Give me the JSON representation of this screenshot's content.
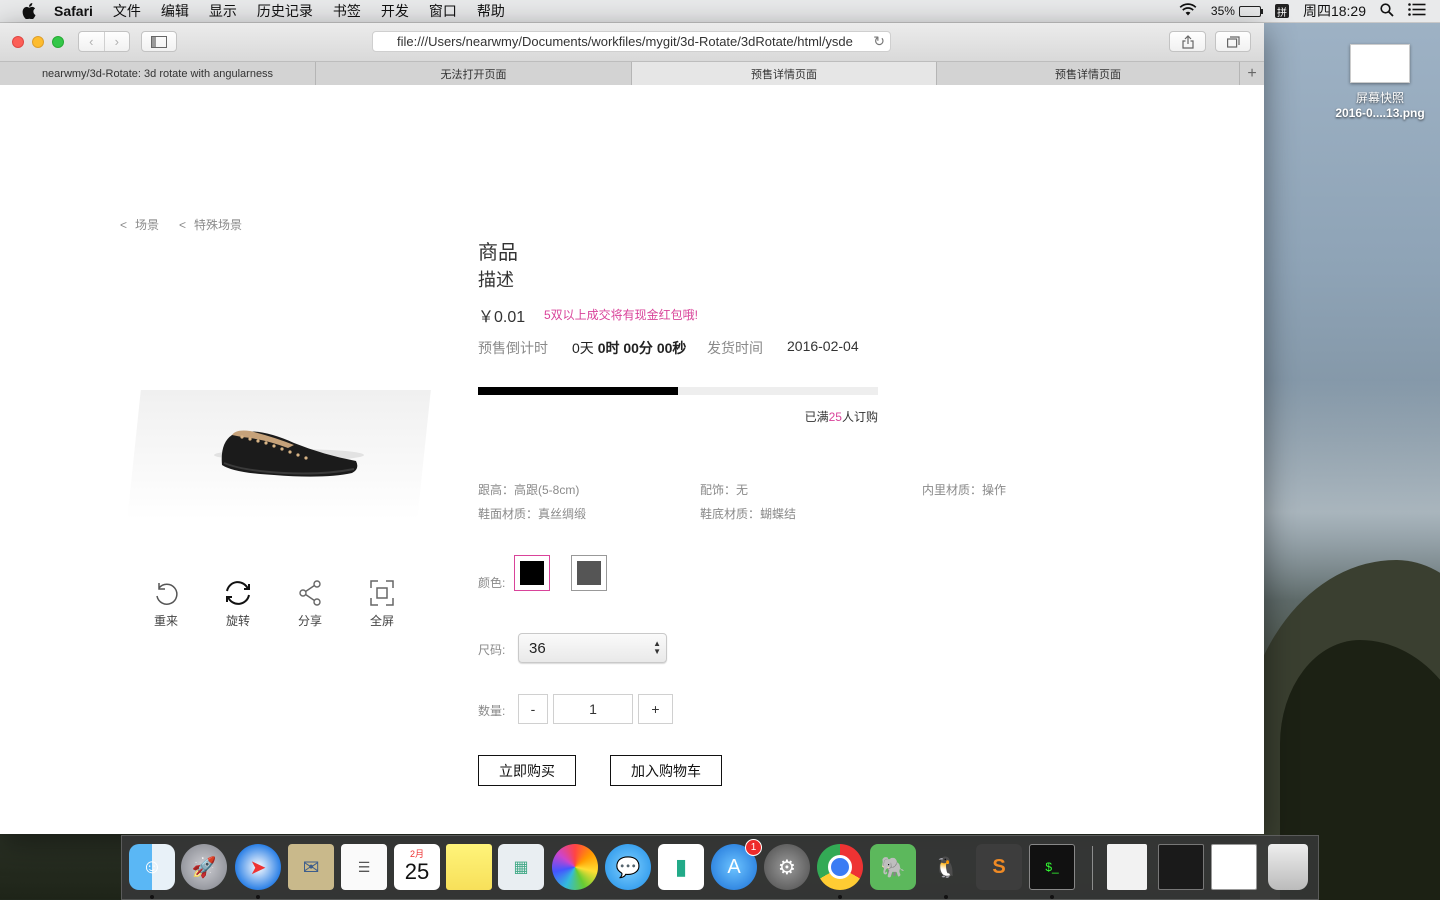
{
  "menubar": {
    "app": "Safari",
    "items": [
      "文件",
      "编辑",
      "显示",
      "历史记录",
      "书签",
      "开发",
      "窗口",
      "帮助"
    ],
    "battery_percent": "35%",
    "battery_level": 0.35,
    "ime": "拼",
    "clock": "周四18:29"
  },
  "browser": {
    "url": "file:///Users/nearwmy/Documents/workfiles/mygit/3d-Rotate/3dRotate/html/ysde",
    "tabs": [
      {
        "title": "nearwmy/3d-Rotate: 3d rotate with angularness"
      },
      {
        "title": "无法打开页面"
      },
      {
        "title": "预售详情页面"
      },
      {
        "title": "预售详情页面"
      }
    ],
    "active_tab": 2
  },
  "page": {
    "breadcrumb": [
      "场景",
      "特殊场景"
    ],
    "breadcrumb_sep": "<",
    "controls": [
      {
        "label": "重来",
        "icon": "reset-icon"
      },
      {
        "label": "旋转",
        "icon": "rotate-icon"
      },
      {
        "label": "分享",
        "icon": "share-icon"
      },
      {
        "label": "全屏",
        "icon": "fullscreen-icon"
      }
    ],
    "product": {
      "title": "商品",
      "desc": "描述",
      "price": "￥0.01",
      "promo": "5双以上成交将有现金红包哦!",
      "countdown_label": "预售倒计时",
      "countdown_day": "0天",
      "countdown_time": "0时 00分 00秒",
      "ship_label": "发货时间",
      "ship_date": "2016-02-04",
      "progress": 0.5,
      "sold_prefix": "已满",
      "sold_count": "25",
      "sold_suffix": "人订购",
      "specs": [
        "跟高：高跟(5-8cm)",
        "配饰：无",
        "内里材质：操作",
        "鞋面材质：真丝绸缎",
        "鞋底材质：蝴蝶结"
      ],
      "color_label": "颜色:",
      "colors": [
        "#000000",
        "#555555"
      ],
      "selected_color": 0,
      "size_label": "尺码:",
      "size_value": "36",
      "qty_label": "数量:",
      "qty_minus": "-",
      "qty_value": "1",
      "qty_plus": "+",
      "buy_now": "立即购买",
      "add_cart": "加入购物车"
    }
  },
  "desktop": {
    "file_line1": "屏幕快照",
    "file_line2": "2016-0....13.png"
  },
  "dock": {
    "calendar_month": "2月",
    "calendar_day": "25",
    "appstore_badge": "1"
  }
}
